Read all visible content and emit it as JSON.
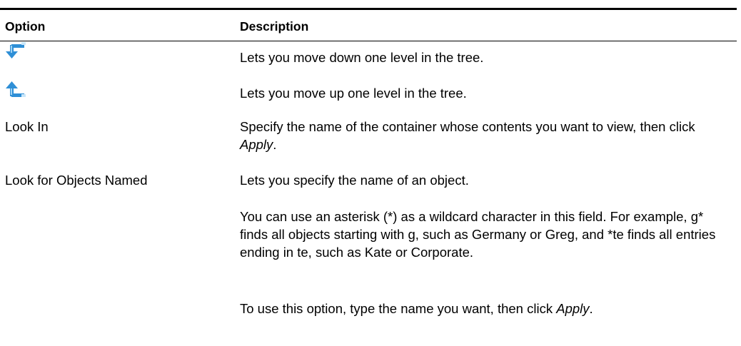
{
  "table": {
    "headers": {
      "option": "Option",
      "description": "Description"
    },
    "rows": [
      {
        "option_icon": "level-down-arrow-icon",
        "description": "Lets you move down one level in the tree."
      },
      {
        "option_icon": "level-up-arrow-icon",
        "description": "Lets you move up one level in the tree."
      },
      {
        "option": "Look In",
        "description_pre": "Specify the name of the container whose contents you want to view, then click ",
        "description_em": "Apply",
        "description_post": "."
      },
      {
        "option": "Look for Objects Named",
        "description": "Lets you specify the name of an object.",
        "description_2": "You can use an asterisk (*) as a wildcard character in this field. For example, g* finds all objects starting with g, such as Germany or Greg, and *te finds all entries ending in te, such as Kate or Corporate.",
        "description_3_pre": "To use this option, type the name you want, then click ",
        "description_3_em": "Apply",
        "description_3_post": "."
      }
    ]
  },
  "colors": {
    "icon_blue": "#2f8fd6",
    "icon_light": "#9fd3f5",
    "icon_dark": "#1a5f9c"
  }
}
